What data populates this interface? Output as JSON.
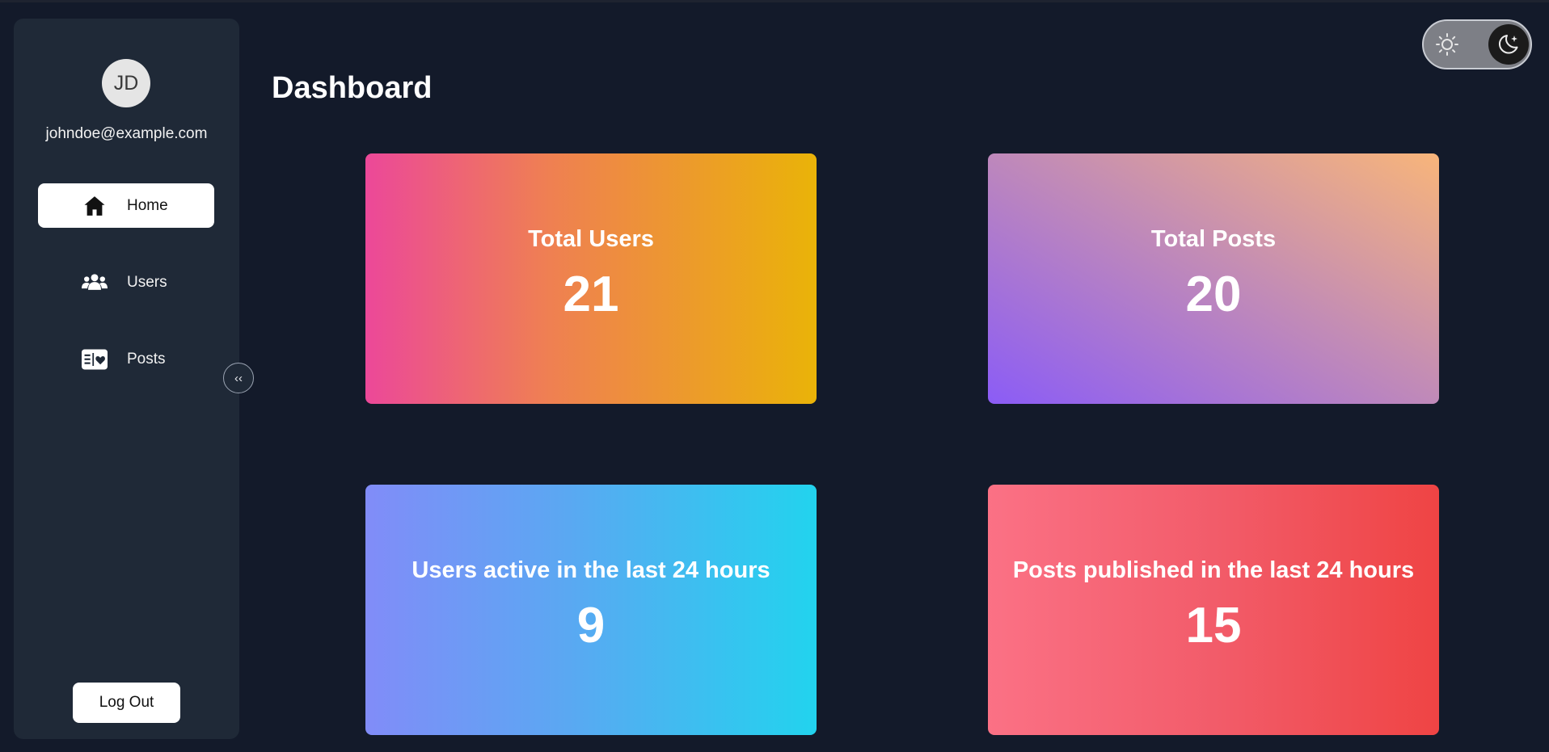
{
  "user": {
    "initials": "JD",
    "email": "johndoe@example.com"
  },
  "sidebar": {
    "items": [
      {
        "label": "Home",
        "icon": "home-icon",
        "active": true
      },
      {
        "label": "Users",
        "icon": "users-icon",
        "active": false
      },
      {
        "label": "Posts",
        "icon": "posts-icon",
        "active": false
      }
    ],
    "collapse_label": "‹‹",
    "logout_label": "Log Out"
  },
  "header": {
    "title": "Dashboard"
  },
  "theme": {
    "mode": "dark",
    "light_icon": "sun-icon",
    "dark_icon": "moon-icon"
  },
  "stats": [
    {
      "label": "Total Users",
      "value": "21"
    },
    {
      "label": "Total Posts",
      "value": "20"
    },
    {
      "label": "Users active in the last 24 hours",
      "value": "9"
    },
    {
      "label": "Posts published in the last 24 hours",
      "value": "15"
    }
  ],
  "colors": {
    "background": "#131a2a",
    "sidebar": "#1f2937"
  }
}
